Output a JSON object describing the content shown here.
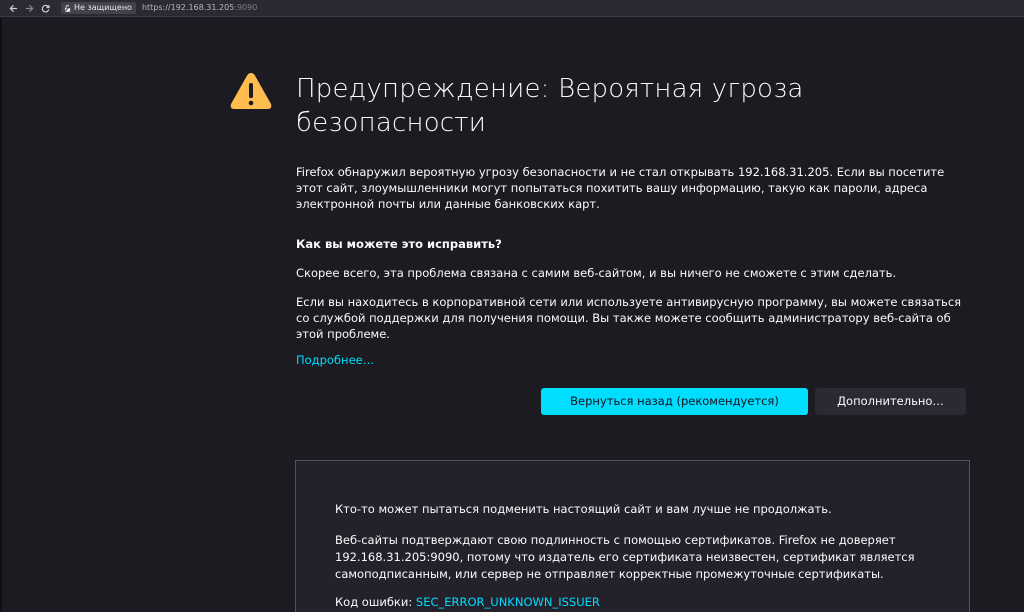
{
  "toolbar": {
    "back_icon": "arrow-left-icon",
    "forward_icon": "arrow-right-icon",
    "reload_icon": "reload-icon",
    "security_badge": "Не защищено",
    "url_main": "https://192.168.31.205",
    "url_port": ":9090"
  },
  "error_page": {
    "icon": "warning-icon",
    "title": "Предупреждение: Вероятная угроза безопасности",
    "intro": "Firefox обнаружил вероятную угрозу безопасности и не стал открывать 192.168.31.205. Если вы посетите этот сайт, злоумышленники могут попытаться похитить вашу информацию, такую как пароли, адреса электронной почты или данные банковских карт.",
    "fix_heading": "Как вы можете это исправить?",
    "fix_cause": "Скорее всего, эта проблема связана с самим веб-сайтом, и вы ничего не сможете с этим сделать.",
    "fix_corporate": "Если вы находитесь в корпоративной сети или используете антивирусную программу, вы можете связаться со службой поддержки для получения помощи. Вы также можете сообщить администратору веб-сайта об этой проблеме.",
    "learn_more": "Подробнее…",
    "go_back_button": "Вернуться назад (рекомендуется)",
    "advanced_button": "Дополнительно…"
  },
  "details": {
    "spoof_text": "Кто-то может пытаться подменить настоящий сайт и вам лучше не продолжать.",
    "certs_text": "Веб-сайты подтверждают свою подлинность с помощью сертификатов. Firefox не доверяет 192.168.31.205:9090, потому что издатель его сертификата неизвестен, сертификат является самоподписанным, или сервер не отправляет корректные промежуточные сертификаты.",
    "error_code_label": "Код ошибки:",
    "error_code": "SEC_ERROR_UNKNOWN_ISSUER"
  },
  "colors": {
    "background": "#1c1b22",
    "accent": "#00ddff",
    "warning": "#ffbd4f"
  }
}
